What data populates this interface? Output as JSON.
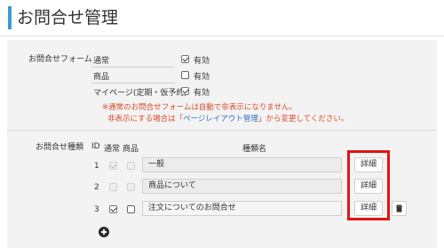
{
  "header": {
    "title": "お問合せ管理"
  },
  "form_section": {
    "label": "お問合せフォーム",
    "forms": [
      {
        "name": "通常",
        "enabled_label": "有効",
        "checked": true
      },
      {
        "name": "商品",
        "enabled_label": "有効",
        "checked": false
      },
      {
        "name": "マイページ(定期・仮予約)",
        "enabled_label": "有効",
        "checked": true
      }
    ],
    "notice": {
      "line1": "※通常のお問合せフォームは自動で非表示になりません。",
      "line2_before": "非表示にする場合は「",
      "line2_link": "ページレイアウト管理",
      "line2_after": "」から変更してください。"
    }
  },
  "types_section": {
    "label": "お問合せ種類",
    "columns": {
      "id": "ID",
      "normal": "通常",
      "product": "商品",
      "type_name": "種類名"
    },
    "rows": [
      {
        "id": "1",
        "name": "一般",
        "normal": true,
        "product": false,
        "editable": false,
        "detail_label": "詳細",
        "deletable": false
      },
      {
        "id": "2",
        "name": "商品について",
        "normal": false,
        "product": false,
        "editable": false,
        "detail_label": "詳細",
        "deletable": false
      },
      {
        "id": "3",
        "name": "注文についてのお問合せ",
        "normal": true,
        "product": false,
        "editable": true,
        "detail_label": "詳細",
        "deletable": true
      }
    ]
  },
  "colors": {
    "accent": "#3b9bd6",
    "highlight": "#e01414",
    "notice": "#d94a2b",
    "link": "#2a74c5"
  }
}
